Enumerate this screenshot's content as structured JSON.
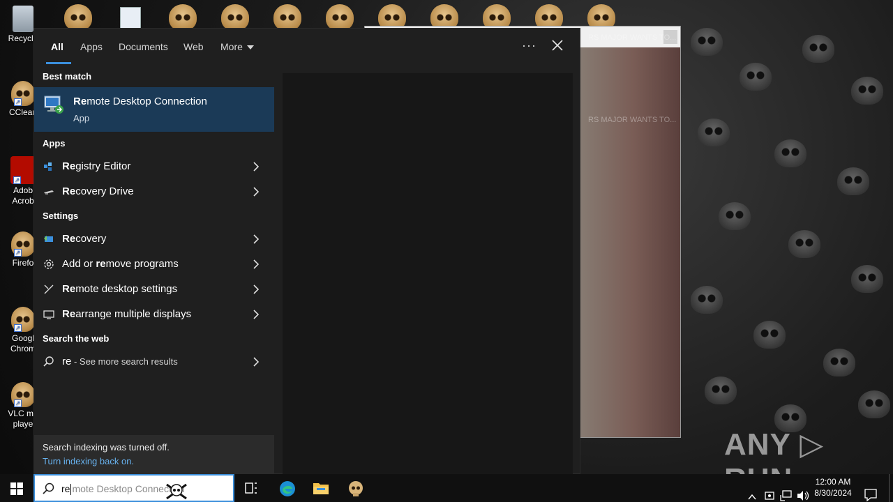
{
  "desktop": {
    "icons": [
      {
        "label": "Recycle"
      },
      {
        "label": "CClean"
      },
      {
        "label": "Adob Acrob"
      },
      {
        "label": "Firefo"
      },
      {
        "label": "Googl Chrom"
      },
      {
        "label": "VLC me playe"
      }
    ],
    "background_window": {
      "faint_text_1": "RS MAJOR WANTS TO...",
      "faint_text_2": "RS MAJOR WANTS TO..."
    }
  },
  "search_panel": {
    "tabs": [
      {
        "label": "All",
        "active": true
      },
      {
        "label": "Apps"
      },
      {
        "label": "Documents"
      },
      {
        "label": "Web"
      },
      {
        "label": "More"
      }
    ],
    "more_options": "···",
    "best_match": {
      "header": "Best match",
      "title_bold": "Re",
      "title_rest": "mote Desktop Connection",
      "subtitle": "App"
    },
    "apps": {
      "header": "Apps",
      "items": [
        {
          "bold": "Re",
          "rest": "gistry Editor",
          "icon": "registry-icon"
        },
        {
          "bold": "Re",
          "rest": "covery Drive",
          "icon": "drive-icon"
        }
      ]
    },
    "settings": {
      "header": "Settings",
      "items": [
        {
          "pre": "",
          "bold": "Re",
          "rest": "covery",
          "icon": "recovery-icon"
        },
        {
          "pre": "Add or ",
          "bold": "re",
          "rest": "move programs",
          "icon": "gear-icon"
        },
        {
          "pre": "",
          "bold": "Re",
          "rest": "mote desktop settings",
          "icon": "remote-settings-icon"
        },
        {
          "pre": "",
          "bold": "Re",
          "rest": "arrange multiple displays",
          "icon": "display-icon"
        }
      ]
    },
    "web": {
      "header": "Search the web",
      "query": "re",
      "hint": " - See more search results"
    },
    "index_notice": {
      "line1": "Search indexing was turned off.",
      "line2": "Turn indexing back on."
    }
  },
  "taskbar": {
    "search_typed": "re",
    "search_ghost": "mote Desktop Connection",
    "clock_time": "12:00 AM",
    "clock_date": "8/30/2024"
  },
  "watermark": "ANY ▷ RUN",
  "colors": {
    "accent": "#3b8fdc",
    "best_match_bg": "#1b3a57",
    "panel_bg": "#1f1f1f",
    "link": "#68b3f0"
  }
}
